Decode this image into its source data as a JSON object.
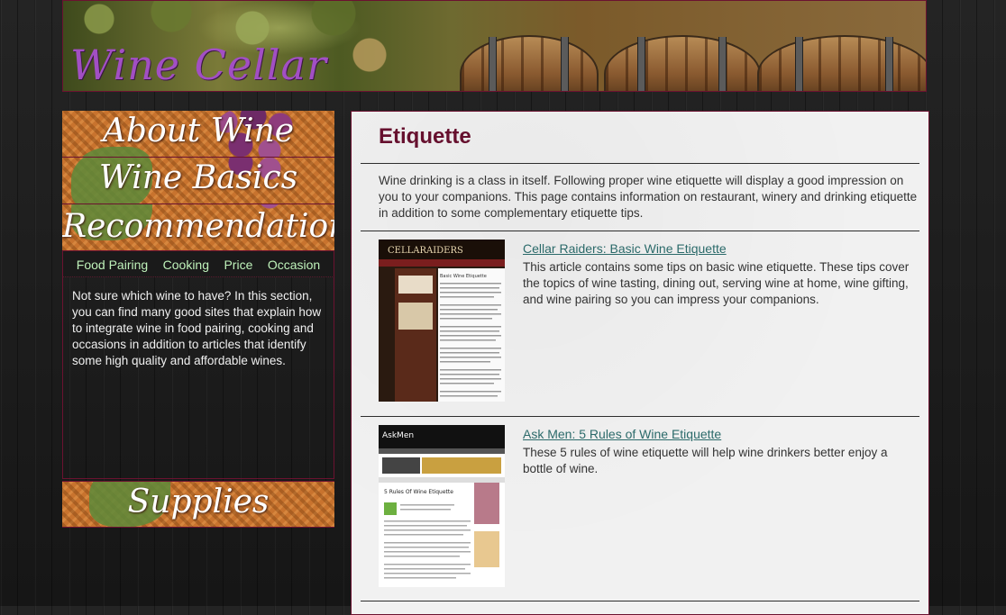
{
  "site": {
    "title": "Wine Cellar"
  },
  "nav": {
    "about": "About Wine",
    "basics": "Wine Basics",
    "recommendations": "Recommendations",
    "supplies": "Supplies"
  },
  "subnav": [
    "Food Pairing",
    "Cooking",
    "Price",
    "Occasion"
  ],
  "sidebar": {
    "text": "Not sure which wine to have? In this section, you can find many good sites that explain how to integrate wine in food pairing, cooking and occasions in addition to articles that identify some high quality and affordable wines."
  },
  "page": {
    "title": "Etiquette",
    "intro": "Wine drinking is a class in itself. Following proper wine etiquette will display a good impression on you to your companions. This page contains information on restaurant, winery and drinking etiquette in addition to some complementary etiquette tips."
  },
  "articles": [
    {
      "title": "Cellar Raiders: Basic Wine Etiquette",
      "description": "This article contains some tips on basic wine etiquette. These tips cover the topics of wine tasting, dining out, serving wine at home, wine gifting, and wine pairing so you can impress your companions.",
      "thumb_brand": "CELLARAIDERS",
      "thumb_heading": "Basic Wine Etiquette"
    },
    {
      "title": "Ask Men: 5 Rules of Wine Etiquette",
      "description": "These 5 rules of wine etiquette will help wine drinkers better enjoy a bottle of wine.",
      "thumb_brand": "AskMen",
      "thumb_heading": "5 Rules Of Wine Etiquette"
    }
  ],
  "colors": {
    "title_purple": "#a24fc4",
    "heading_maroon": "#66102e",
    "subnav_green": "#bff2ba",
    "link_teal": "#2b6a6a",
    "border_maroon": "#6b1230"
  }
}
